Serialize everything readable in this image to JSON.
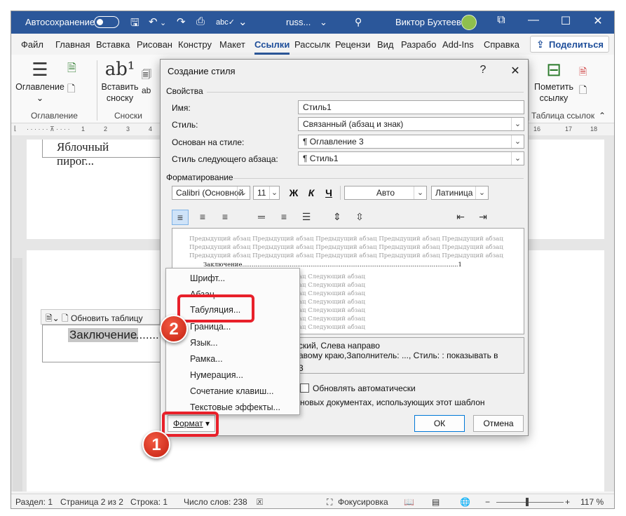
{
  "titlebar": {
    "autosave_label": "Автосохранение",
    "doc_name": "russ...",
    "search_icon": "search-icon",
    "user_name": "Виктор Бухтеев",
    "colors": {
      "bar": "#2b579a"
    }
  },
  "tabs": [
    "Файл",
    "Главная",
    "Вставка",
    "Рисован",
    "Констру",
    "Макет",
    "Ссылки",
    "Рассылк",
    "Рецензи",
    "Вид",
    "Разрабо",
    "Add-Ins",
    "Справка"
  ],
  "active_tab": "Ссылки",
  "share_label": "Поделиться",
  "ribbon": {
    "toc_button": "Оглавление",
    "insert_footnote": "Вставить\nсноску",
    "mark_citation": "Пометить\nссылку",
    "group_toc": "Оглавление",
    "group_footnotes": "Сноски",
    "group_toa": "Таблица ссылок"
  },
  "ruler_marks": [
    "1",
    "2",
    "3",
    "4",
    "16",
    "17",
    "18"
  ],
  "document": {
    "line1": "Яблочный пирог...",
    "toc_toolbar_label": "Обновить таблицу",
    "toc_entry": "Заключение"
  },
  "status": {
    "section": "Раздел: 1",
    "page": "Страница 2 из 2",
    "line": "Строка: 1",
    "words": "Число слов: 238",
    "focus": "Фокусировка",
    "zoom": "117 %"
  },
  "dialog": {
    "title": "Создание стиля",
    "help": "?",
    "close": "✕",
    "section_props": "Свойства",
    "name_label": "Имя:",
    "name_value": "Стиль1",
    "style_label": "Стиль:",
    "style_value": "Связанный (абзац и знак)",
    "based_label": "Основан на стиле:",
    "based_value": "¶  Оглавление 3",
    "next_label": "Стиль следующего абзаца:",
    "next_value": "¶  Стиль1",
    "section_format": "Форматирование",
    "font": "Calibri (Основной",
    "size": "11",
    "bold": "Ж",
    "italic": "К",
    "underline": "Ч",
    "color": "Авто",
    "script": "Латиница",
    "preview_prev": "Предыдущий абзац Предыдущий абзац Предыдущий абзац Предыдущий абзац Предыдущий абзац",
    "preview_current": "Заключение..................................................................................................................1",
    "preview_next": "Следующий абзац Следующий абзац Следующий абзац",
    "desc_line1": "ский, Слева направо",
    "desc_line2": "авому краю,Заполнитель: ..., Стиль: : показывать в",
    "desc_line3": "3",
    "auto_update": "Обновлять автоматически",
    "new_docs": "новых документах, использующих этот шаблон",
    "format_button": "Формат",
    "ok": "ОК",
    "cancel": "Отмена"
  },
  "menu": [
    "Шрифт...",
    "Абзац...",
    "Табуляция...",
    "Граница...",
    "Язык...",
    "Рамка...",
    "Нумерация...",
    "Сочетание клавиш...",
    "Текстовые эффекты..."
  ],
  "annotations": {
    "step1": "1",
    "step2": "2",
    "color": "#e8202a"
  }
}
